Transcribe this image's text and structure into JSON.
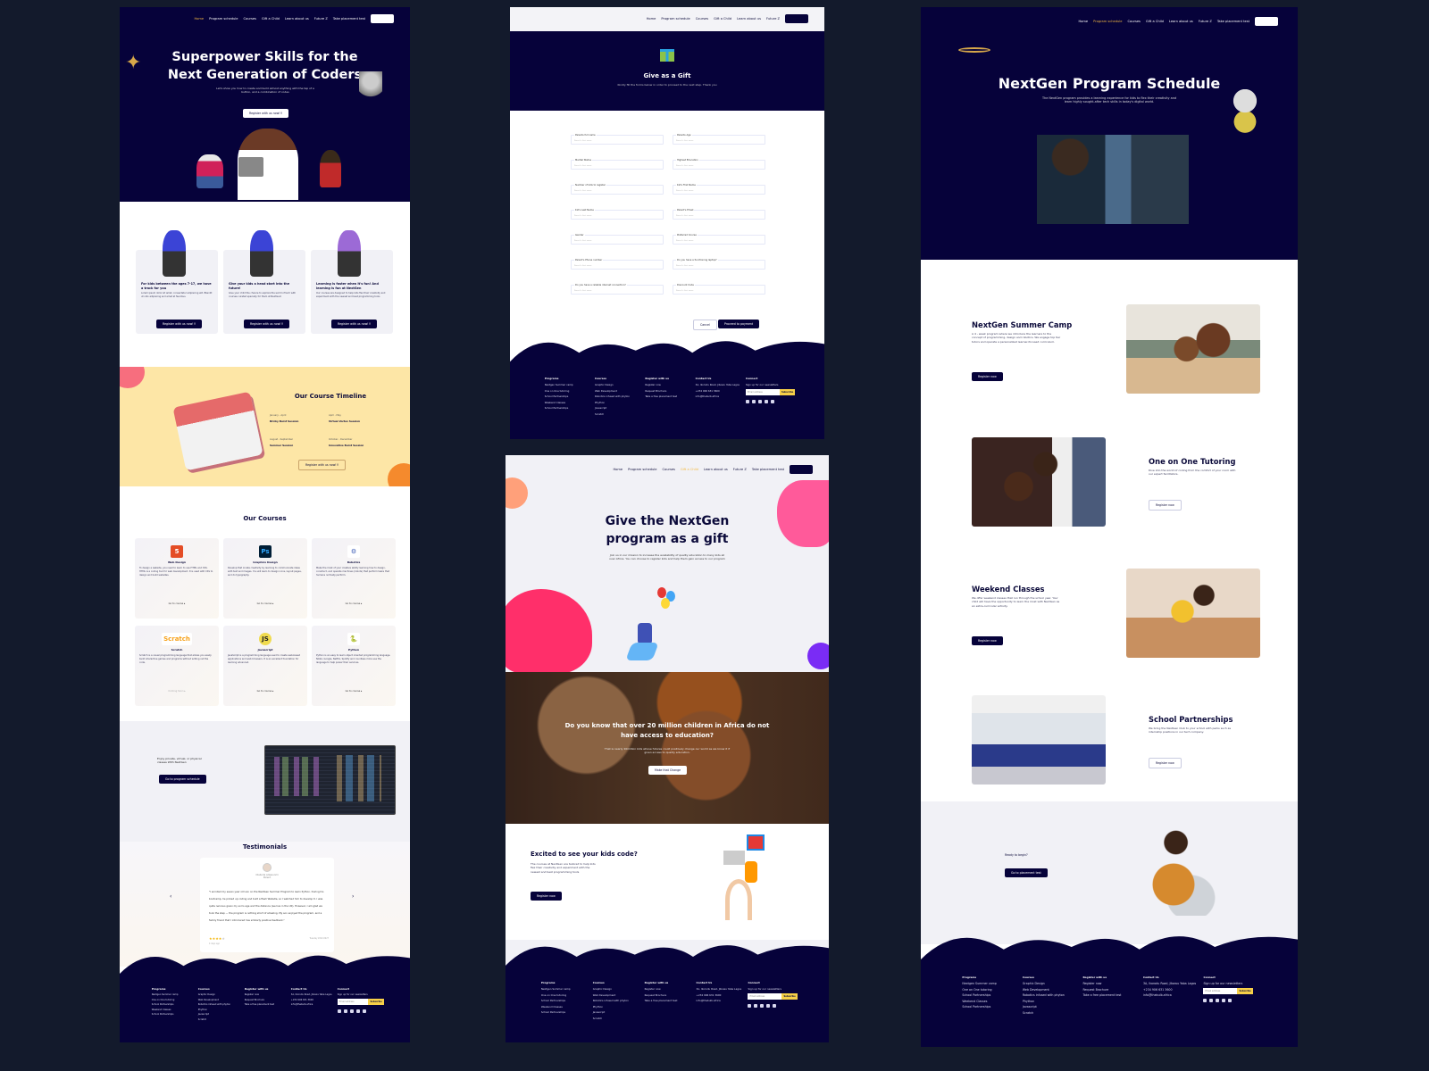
{
  "colors": {
    "navy": "#06023a",
    "accent": "#f4b942",
    "yellow": "#fde6a6",
    "pink": "#ff5a9a",
    "subscribe": "#f7d048",
    "background": "#131a2c"
  },
  "nav": {
    "items": [
      "Home",
      "Program schedule",
      "Courses",
      "Gift a Child",
      "Learn about us",
      "Future Z",
      "Take placement test"
    ],
    "register": "Register"
  },
  "home": {
    "hero": {
      "title_line1": "Superpower Skills for the",
      "title_line2": "Next Generation of Coders",
      "subtitle": "Let's show you how to create and build almost anything with the tap of a button, and a combination of codes",
      "cta": "Register with us now!!!"
    },
    "features": [
      {
        "title": "For kids between the ages 7-17, we have a track for you",
        "text": "Lorem ipsum dolor sit amet, consectetur adipiscing elit. Blandit ut odio adipiscing and amet at faucibus.",
        "cta": "Register with us now!!!"
      },
      {
        "title": "Give your kids a head start into the future!",
        "text": "Give your child the chance to explore the world of tech with courses curated specially for them at NextGen!",
        "cta": "Register with us now!!!"
      },
      {
        "title": "Learning is faster when it's fun! And learning is fun at NextGen",
        "text": "Our courses are designed to help kids flex their creativity and experiment with the newest and best programming tools",
        "cta": "Register with us now!!!"
      }
    ],
    "timeline": {
      "title": "Our Course Timeline",
      "entries": [
        {
          "period": "January - April",
          "name": "Bricky Burst Session"
        },
        {
          "period": "April - May",
          "name": "Virtual Vortex Session"
        },
        {
          "period": "August - September",
          "name": "Summer Session"
        },
        {
          "period": "October - December",
          "name": "Innovative Burst Session"
        }
      ],
      "cta": "Register with us now!!!"
    },
    "courses": {
      "title": "Our Courses",
      "items": [
        {
          "icon": "html5-icon",
          "name": "Web Design",
          "text": "To design a website, you need to learn to use HTML and CSS. HTML is a coding tool for web development. It is used with CSS to design and build websites.",
          "link": "Go to course ▸"
        },
        {
          "icon": "photoshop-icon",
          "name": "Graphics Design",
          "text": "Develop that innate creativity by learning to communicate ideas with text and images. You will learn to design icons, layout pages, and do typography.",
          "link": "Go to course ▸"
        },
        {
          "icon": "robot-icon",
          "name": "Robotics",
          "text": "Make the most of your creative ability learning how to design, construct, and operate machines (robots) that perform tasks that humans normally perform.",
          "link": "Go to course ▸"
        },
        {
          "icon": "scratch-icon",
          "name": "Scratch",
          "text": "Scratch is a visual programming language that allows you easily build interactive games and programs without writing out the code.",
          "link": "Coming Soon ▸"
        },
        {
          "icon": "javascript-icon",
          "name": "Javascript",
          "text": "JavaScript is a programming language used to create web-based applications and web browsers. It is an excellent foundation for learning advanced.",
          "link": "Go to course ▸"
        },
        {
          "icon": "python-icon",
          "name": "Python",
          "text": "Python is an easy to learn object oriented programming language. NASA, Google, Netflix, Spotify and countless more use the language to help power their services.",
          "link": "Go to course ▸"
        }
      ]
    },
    "schedule_promo": {
      "text": "Enjoy private, virtual, or physical classes With NextGen",
      "cta": "Go to program schedule"
    },
    "testimonials": {
      "title": "Testimonials",
      "name": "Olabode Adewunmi",
      "role": "Parent",
      "quote": "\"I enrolled my seven year old son on the NextGen Summer Program to learn Python. During his bootcamp, he picked up coding and built a flash Website, so I watched him to develop it. I was quite nervous given my son's age and the distance (we live in the UK). However, I am glad we took the step — the program is nothing short of amazing. My son enjoyed the program, and a family friend that I introduced has similarly positive feedback.\"",
      "rating": 4,
      "rating_max": 5,
      "time": "4 days ago",
      "date": "Tuesday 2022-0927"
    }
  },
  "gift_form": {
    "title": "Give as a Gift",
    "subtitle": "Kindly fill the forms below in order to proceed to the next step. Thank you",
    "placeholder": "Parent's first name",
    "fields": [
      "Parents full name",
      "Parents Age",
      "Marital Status",
      "Highest Education",
      "Number of kids to register",
      "Kid's First Name",
      "Kid's Last Name",
      "Parent's Email",
      "Gender",
      "Preferred Course",
      "Parent's Phone number",
      "Do you have a functioning laptop?",
      "Do you have a reliable internet connection?",
      "Discount Code"
    ],
    "cancel": "Cancel",
    "proceed": "Proceed to payment"
  },
  "gift_landing": {
    "title_line1": "Give the NextGen",
    "title_line2": "program as a gift",
    "subtitle": "Join us in our mission to increase the availability of quality education to many kids all over Africa. You can choose to register kids and help them gain access to our program",
    "banner": {
      "title": "Do you know that over 20 million children in Africa do not have access to education?",
      "text": "That is nearly 20million kids whose futures could positively change our world as we know it if given access to quality education.",
      "cta": "Make that Change"
    },
    "excited": {
      "title": "Excited to see your kids code?",
      "text": "The courses at NextGen are tailored to help kids flex their creativity and experiment with the newest and best programming tools",
      "cta": "Register now"
    }
  },
  "schedule": {
    "title": "NextGen Program Schedule",
    "subtitle": "The NextGen program provides a learning experience for kids to flex their creativity and learn highly sought-after tech skills in today's digital world.",
    "programs": [
      {
        "title": "NextGen Summer Camp",
        "text": "A 4 - week program where we introduce the learners to the concept of programming, design and robotics. We engage top tier tutors and operate a personalized learner-focused curriculum.",
        "cta": "Register now"
      },
      {
        "title": "One on One Tutoring",
        "text": "Dive into the world of coding from the comfort of your room with our expert facilitators.",
        "cta": "Register now"
      },
      {
        "title": "Weekend Classes",
        "text": "We offer weekend classes that run through the school year. Your child will have the opportunity to learn the most with NextGen as an extra-curricular activity.",
        "cta": "Register now"
      },
      {
        "title": "School Partnerships",
        "text": "We bring the NextGen Club to your school with perks such as internship positions in our tech company.",
        "cta": "Register now"
      }
    ],
    "ready": {
      "text": "Ready to begin?",
      "cta": "Go to placement test"
    }
  },
  "footer": {
    "columns": [
      {
        "title": "Programs",
        "items": [
          "Nextgen Summer camp",
          "One on One tutoring",
          "School Partnerships",
          "Weekend Classes",
          "School Partnerships"
        ]
      },
      {
        "title": "Courses",
        "items": [
          "Graphic Design",
          "Web Development",
          "Robotics infused with phyton",
          "Phython",
          "Javascript",
          "Scratch"
        ]
      },
      {
        "title": "Register with us",
        "items": [
          "Register now",
          "Request Brochure",
          "Take a free placement test"
        ]
      },
      {
        "title": "Contact Us",
        "items": [
          "3A, Ikorodu Road, Jibowu Yaba Lagos",
          "+234 906 631 3600",
          "info@thebulb.africa"
        ]
      }
    ],
    "connect": {
      "title": "Connect",
      "text": "Sign up for our newsletters",
      "placeholder": "Email address",
      "subscribe": "Subscribe"
    },
    "social": [
      "facebook-icon",
      "twitter-icon",
      "instagram-icon",
      "linkedin-icon",
      "youtube-icon"
    ]
  }
}
